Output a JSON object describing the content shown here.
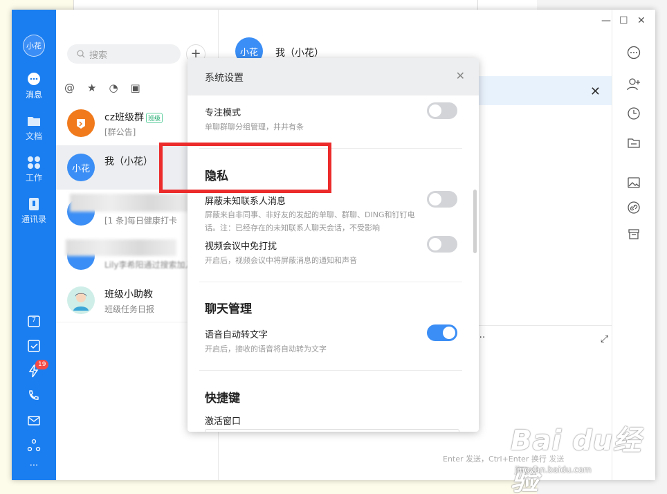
{
  "left_nav": {
    "avatar_text": "小花",
    "items": [
      {
        "label": "消息",
        "icon": "chat-bubble-icon"
      },
      {
        "label": "文档",
        "icon": "folder-icon"
      },
      {
        "label": "工作",
        "icon": "grid-icon"
      },
      {
        "label": "通讯录",
        "icon": "contacts-icon"
      }
    ],
    "bottom": {
      "calendar_day": "7",
      "ding_badge": "19",
      "more": "···"
    }
  },
  "conversation_list": {
    "search_placeholder": "搜索",
    "plus_label": "+",
    "filters": [
      "@",
      "★",
      "◔",
      "▣"
    ],
    "items": [
      {
        "avatar": "",
        "name": "cz班级群",
        "tag": "班级",
        "preview": "[群公告]",
        "color": "#f07a1c"
      },
      {
        "avatar": "小花",
        "name": "我（小花）",
        "tag": "",
        "preview": "",
        "color": "#3b8ef5"
      },
      {
        "avatar": "",
        "name": "",
        "tag": "",
        "preview": "[1 条]每日健康打卡",
        "color": "#3b8ef5"
      },
      {
        "avatar": "",
        "name": "",
        "tag": "",
        "preview": "Lily李希阳通过搜索加入",
        "color": "#3b8ef5"
      },
      {
        "avatar": "",
        "name": "班级小助教",
        "tag": "",
        "preview": "班级任务日报",
        "color": "#7fd0c4"
      }
    ]
  },
  "chat": {
    "avatar": "小花",
    "title": "我（小花）",
    "notice_close": "✕",
    "toolbar_more": "···",
    "expand": "⤢",
    "send_hint": "Enter 发送，Ctrl+Enter 换行",
    "send_label": "发送"
  },
  "window_controls": {
    "minimize": "—",
    "maximize": "☐",
    "close": "✕"
  },
  "settings": {
    "title": "系统设置",
    "close": "✕",
    "focus_mode": {
      "title": "专注模式",
      "desc": "单聊群聊分组管理，井井有条",
      "on": false
    },
    "privacy": {
      "heading": "隐私",
      "block_unknown": {
        "title": "屏蔽未知联系人消息",
        "desc": "屏蔽来自非同事、非好友的发起的单聊、群聊、DING和钉钉电话。注：已经存在的未知联系人聊天会话，不受影响",
        "on": false
      },
      "video_dnd": {
        "title": "视频会议中免打扰",
        "desc": "开启后，视频会议中将屏蔽消息的通知和声音",
        "on": false
      }
    },
    "chat_mgmt": {
      "heading": "聊天管理",
      "voice_to_text": {
        "title": "语音自动转文字",
        "desc": "开启后，接收的语音将自动转为文字",
        "on": true
      }
    },
    "shortcuts": {
      "heading": "快捷键",
      "activate": "激活窗口"
    }
  },
  "watermark": {
    "brand": "Bai du经验",
    "url": "jingyan.baidu.com"
  },
  "colors": {
    "nav_blue": "#1a7ef0",
    "accent": "#3b8ef5",
    "highlight_red": "#ec2b2b"
  }
}
